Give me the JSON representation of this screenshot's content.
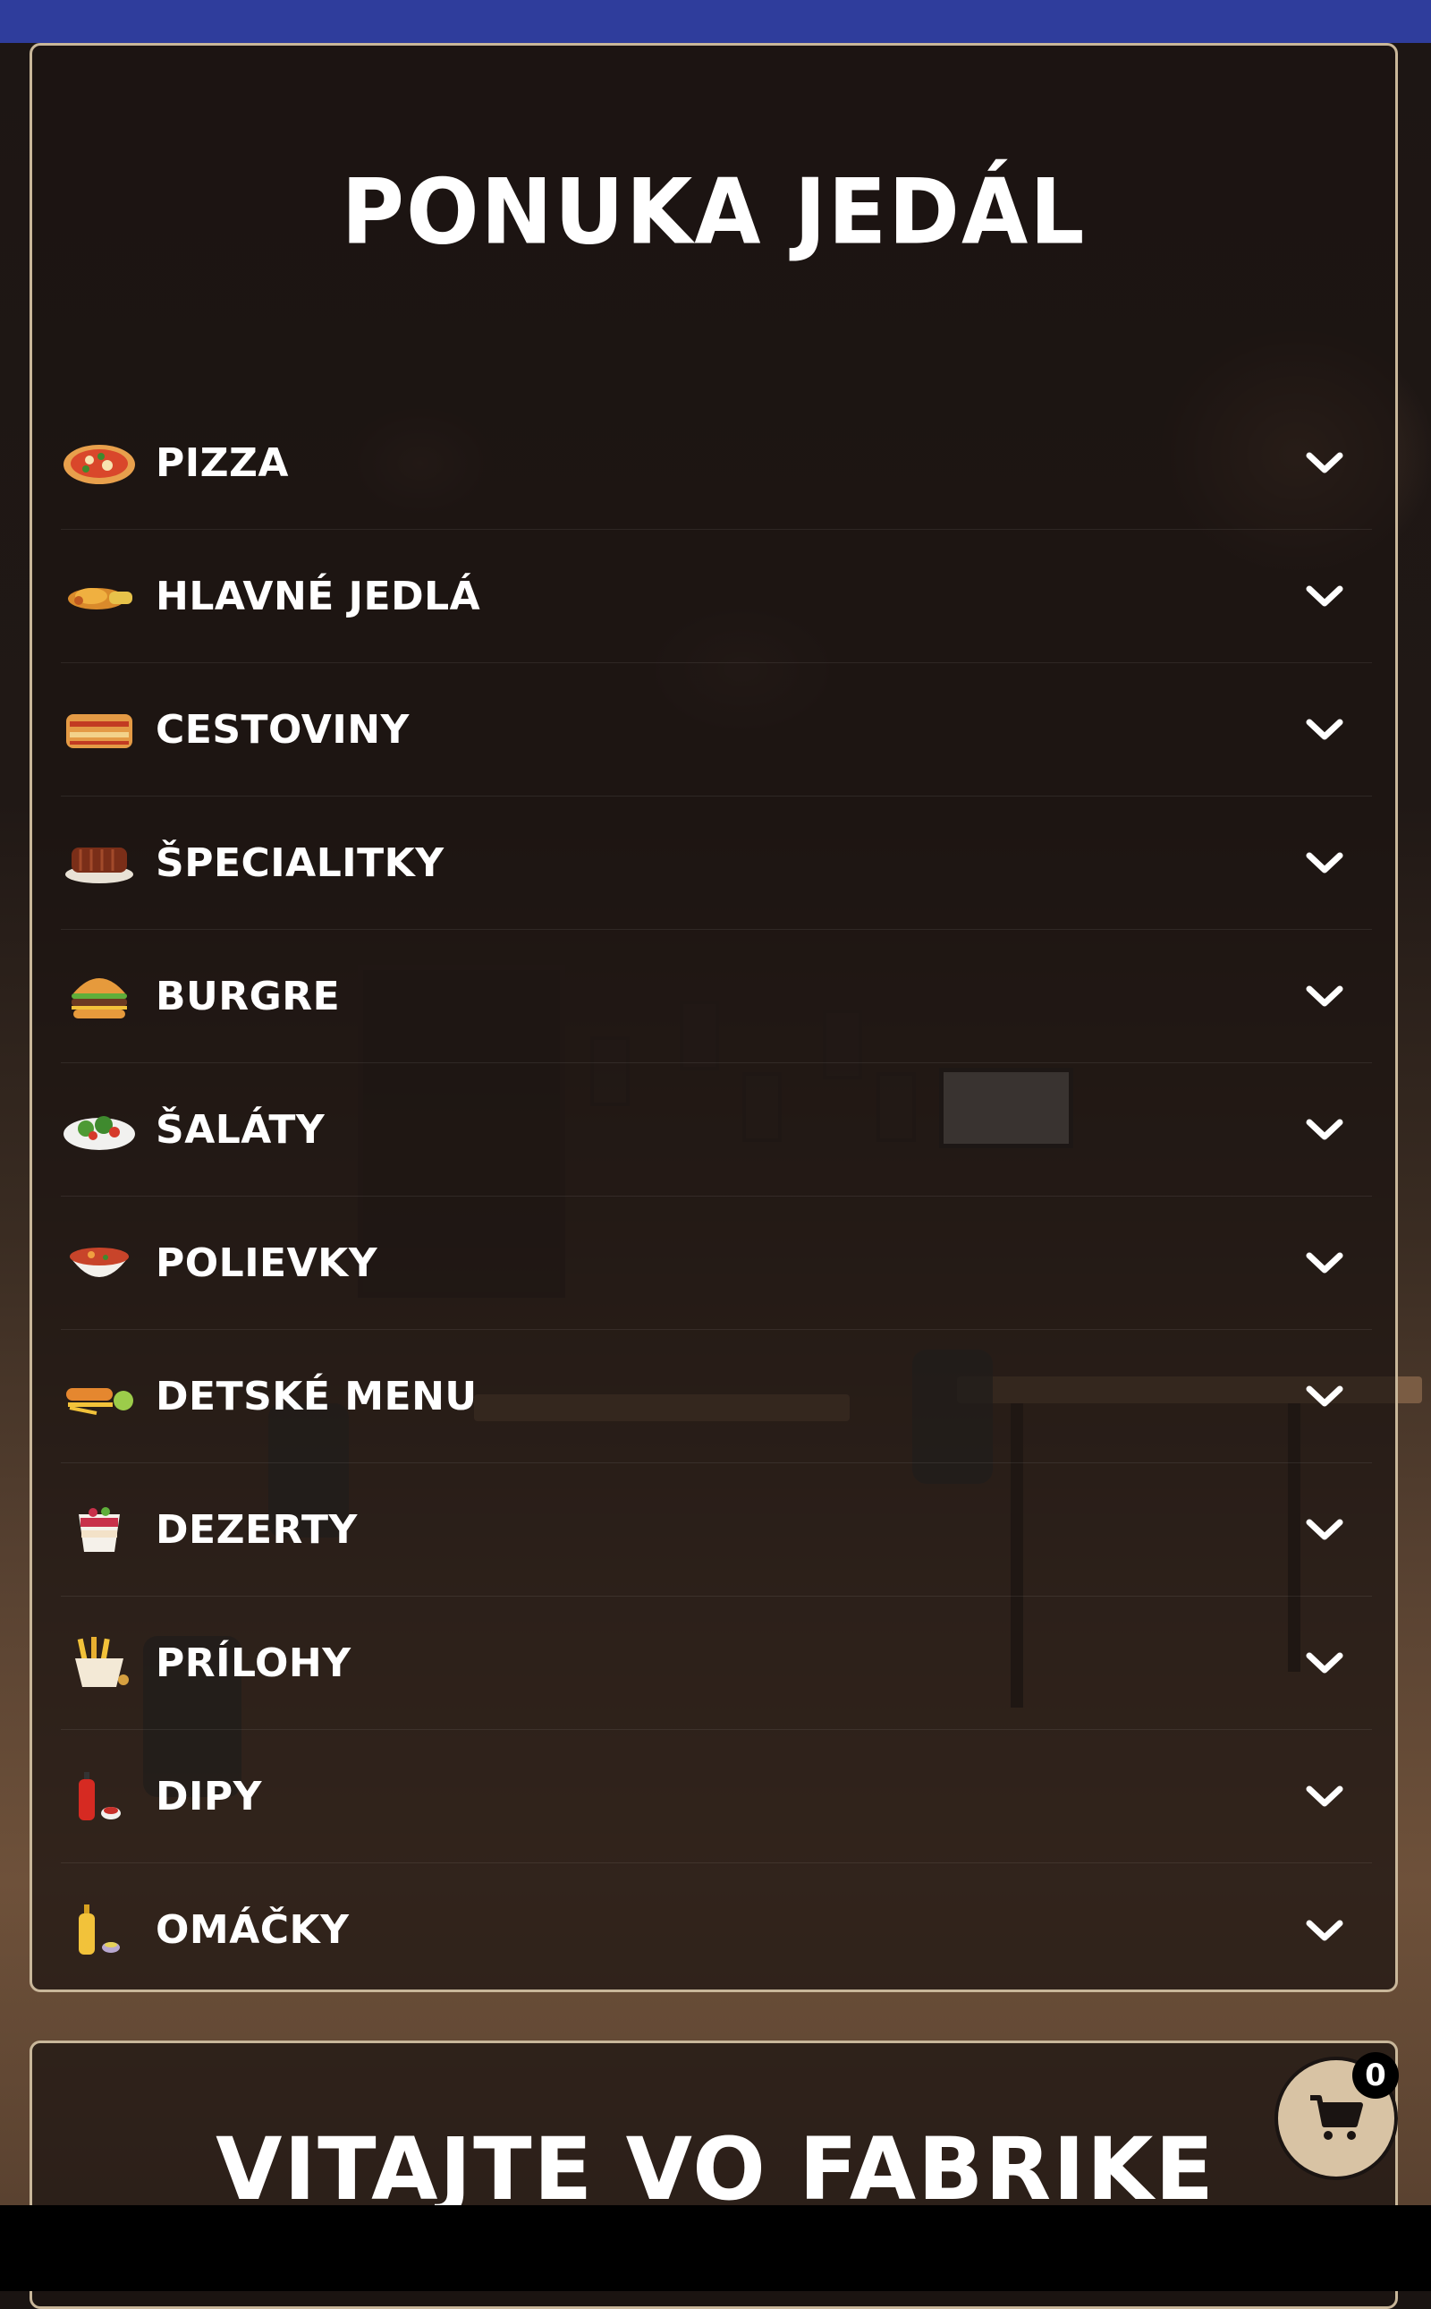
{
  "menu": {
    "title": "PONUKA JEDÁL",
    "categories": [
      {
        "label": "PIZZA",
        "icon": "pizza-icon"
      },
      {
        "label": "HLAVNÉ JEDLÁ",
        "icon": "main-dish-icon"
      },
      {
        "label": "CESTOVINY",
        "icon": "lasagna-icon"
      },
      {
        "label": "ŠPECIALITKY",
        "icon": "ribs-icon"
      },
      {
        "label": "BURGRE",
        "icon": "burger-icon"
      },
      {
        "label": "ŠALÁTY",
        "icon": "salad-icon"
      },
      {
        "label": "POLIEVKY",
        "icon": "soup-icon"
      },
      {
        "label": "DETSKÉ MENU",
        "icon": "kids-menu-icon"
      },
      {
        "label": "DEZERTY",
        "icon": "dessert-icon"
      },
      {
        "label": "PRÍLOHY",
        "icon": "fries-icon"
      },
      {
        "label": "DIPY",
        "icon": "ketchup-icon"
      },
      {
        "label": "OMÁČKY",
        "icon": "mustard-icon"
      }
    ],
    "expand_icon": "chevron-down-icon"
  },
  "welcome": {
    "title": "VITAJTE VO FABRIKE"
  },
  "cart": {
    "count": "0",
    "icon": "cart-icon"
  },
  "colors": {
    "top_bar": "#2f3d9c",
    "card_border": "#c9b79a",
    "cart_button": "#d8c3a4"
  }
}
